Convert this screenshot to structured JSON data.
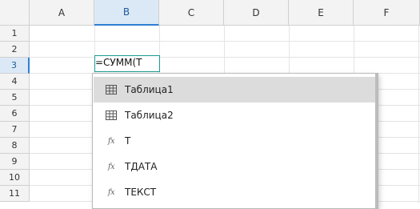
{
  "columns": [
    "A",
    "B",
    "C",
    "D",
    "E",
    "F"
  ],
  "active_column": "B",
  "rows": [
    "1",
    "2",
    "3",
    "4",
    "5",
    "6",
    "7",
    "8",
    "9",
    "10",
    "11"
  ],
  "active_row": "3",
  "edit_cell": {
    "ref": "B3",
    "value": "=СУММ(Т"
  },
  "autocomplete": {
    "items": [
      {
        "label": "Таблица1",
        "icon": "table-icon",
        "selected": true
      },
      {
        "label": "Таблица2",
        "icon": "table-icon",
        "selected": false
      },
      {
        "label": "Т",
        "icon": "function-icon",
        "selected": false
      },
      {
        "label": "ТДАТА",
        "icon": "function-icon",
        "selected": false
      },
      {
        "label": "ТЕКСТ",
        "icon": "function-icon",
        "selected": false
      }
    ]
  },
  "colors": {
    "accent": "#2d7fd0",
    "edit_border": "#1a9a93",
    "selection": "#dcdcdc"
  }
}
